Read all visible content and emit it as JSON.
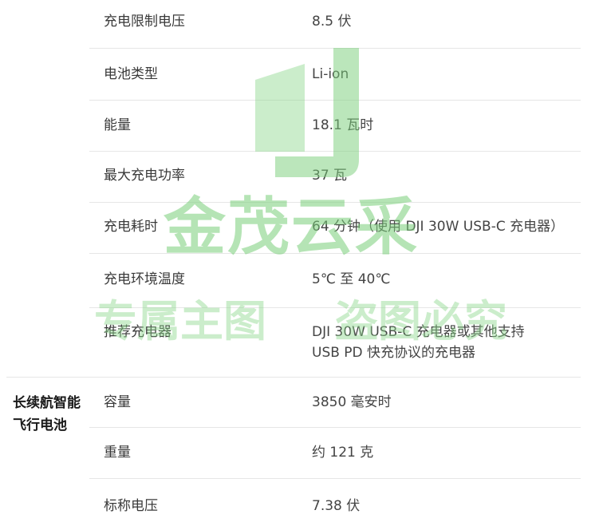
{
  "rows": [
    {
      "label": "充电限制电压",
      "value": "8.5 伏"
    },
    {
      "label": "电池类型",
      "value": "Li-ion"
    },
    {
      "label": "能量",
      "value": "18.1 瓦时"
    },
    {
      "label": "最大充电功率",
      "value": "37 瓦"
    },
    {
      "label": "充电耗时",
      "value": "64 分钟（使用 DJI 30W USB-C 充电器）"
    },
    {
      "label": "充电环境温度",
      "value": "5℃ 至 40℃"
    },
    {
      "label": "推荐充电器",
      "value_line1": "DJI 30W USB-C 充电器或其他支持",
      "value_line2": "USB PD 快充协议的充电器"
    }
  ],
  "section": {
    "title_line1": "长续航智能",
    "title_line2": "飞行电池"
  },
  "section_rows": [
    {
      "label": "容量",
      "value": "3850 毫安时"
    },
    {
      "label": "重量",
      "value": "约 121 克"
    },
    {
      "label": "标称电压",
      "value": "7.38 伏"
    }
  ],
  "watermark": {
    "main": "金茂云采",
    "left": "专属主图",
    "right": "盗图必究"
  },
  "colors": {
    "watermark": "#78cd78",
    "divider": "#e6e6e6",
    "text": "#3a3a3a"
  }
}
